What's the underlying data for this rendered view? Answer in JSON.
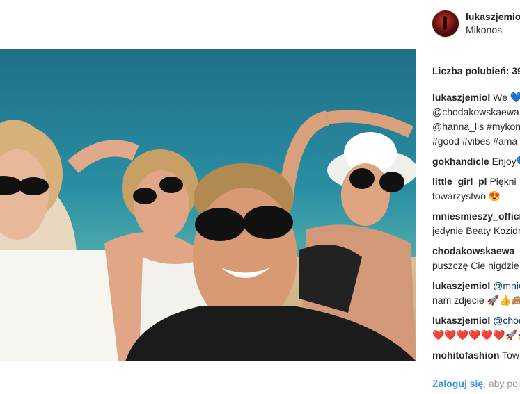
{
  "post": {
    "username": "lukaszjemiol",
    "location": "Mikonos",
    "likes_label": "Liczba polubień: 39"
  },
  "comments": [
    {
      "user": "lukaszjemiol",
      "lines": [
        "We 💙",
        "@chodakowskaewa",
        "@hanna_lis #mykonos",
        "#good #vibes #ama"
      ]
    },
    {
      "user": "gokhandicle",
      "lines": [
        "Enjoy💙"
      ]
    },
    {
      "user": "little_girl_pl",
      "lines": [
        "Piękni",
        "towarzystwo 😍"
      ]
    },
    {
      "user": "mniesmieszy_official",
      "lines": [
        "jedynie Beaty Kozidr"
      ]
    },
    {
      "user": "chodakowskaewa",
      "lines": [
        "puszczę Cie nigdzie"
      ]
    },
    {
      "user": "lukaszjemiol",
      "lines": [
        "@mnie",
        "nam zdjecie 🚀👍🙈"
      ]
    },
    {
      "user": "lukaszjemiol",
      "lines": [
        "@chod",
        "❤️❤️❤️❤️❤️❤️🚀🚀🚀"
      ]
    },
    {
      "user": "mohitofashion",
      "lines": [
        "Tow"
      ]
    }
  ],
  "login": {
    "link_label": "Zaloguj się",
    "rest_label": ", aby pol"
  },
  "colors": {
    "sea": "#2a8fa3",
    "sand": "#d9b98a",
    "link": "#3897f0"
  }
}
